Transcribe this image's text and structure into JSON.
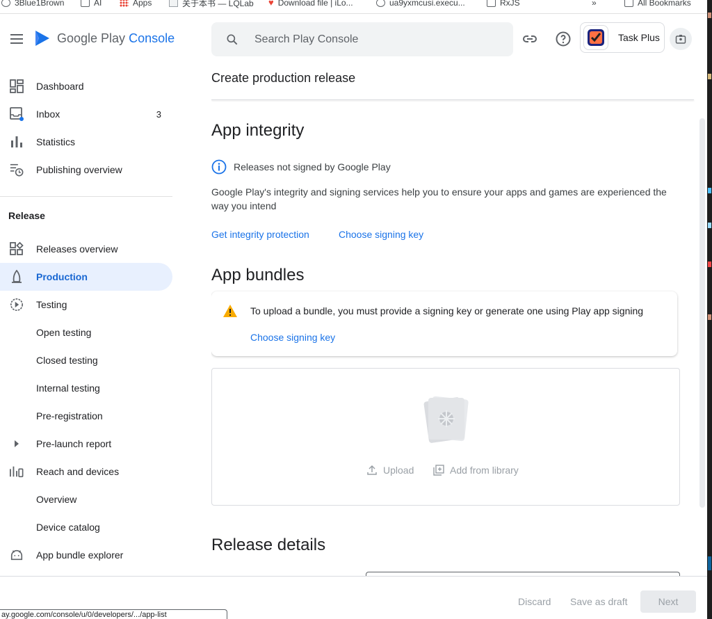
{
  "bookmarks": [
    {
      "label": "3Blue1Brown",
      "icon": "globe-icon"
    },
    {
      "label": "AI",
      "icon": "folder-icon"
    },
    {
      "label": "Apps",
      "icon": "apps-grid-icon"
    },
    {
      "label": "关于本书 — LQLab",
      "icon": "page-icon"
    },
    {
      "label": "Download file | iLo...",
      "icon": "heart-icon"
    },
    {
      "label": "ua9yxmcusi.execu...",
      "icon": "globe-icon"
    },
    {
      "label": "RxJS",
      "icon": "folder-icon"
    }
  ],
  "bookmarks_overflow": "»",
  "bookmarks_all": "All Bookmarks",
  "header": {
    "brand_google": "Google Play",
    "brand_console": "Console",
    "search_placeholder": "Search Play Console",
    "app_name": "Task Plus"
  },
  "sidebar": {
    "top_items": [
      {
        "label": "Dashboard",
        "icon": "dashboard-icon"
      },
      {
        "label": "Inbox",
        "icon": "inbox-icon",
        "count": "3"
      },
      {
        "label": "Statistics",
        "icon": "bar-chart-icon"
      },
      {
        "label": "Publishing overview",
        "icon": "publishing-icon"
      }
    ],
    "release_section": "Release",
    "release_items": [
      {
        "label": "Releases overview",
        "icon": "releases-overview-icon"
      },
      {
        "label": "Production",
        "icon": "production-icon",
        "active": true
      },
      {
        "label": "Testing",
        "icon": "testing-icon"
      },
      {
        "label": "Open testing"
      },
      {
        "label": "Closed testing"
      },
      {
        "label": "Internal testing"
      },
      {
        "label": "Pre-registration"
      },
      {
        "label": "Pre-launch report",
        "icon": "expand-arrow-icon"
      },
      {
        "label": "Reach and devices",
        "icon": "reach-devices-icon"
      },
      {
        "label": "Overview"
      },
      {
        "label": "Device catalog"
      },
      {
        "label": "App bundle explorer",
        "icon": "android-icon"
      }
    ]
  },
  "main": {
    "page_title": "Create production release",
    "integrity": {
      "heading": "App integrity",
      "status": "Releases not signed by Google Play",
      "description": "Google Play's integrity and signing services help you to ensure your apps and games are experienced the way you intend",
      "link_protection": "Get integrity protection",
      "link_signing": "Choose signing key"
    },
    "bundles": {
      "heading": "App bundles",
      "warning": "To upload a bundle, you must provide a signing key or generate one using Play app signing",
      "warning_link": "Choose signing key",
      "upload_label": "Upload",
      "library_label": "Add from library"
    },
    "release_details_heading": "Release details"
  },
  "footer": {
    "discard": "Discard",
    "save_draft": "Save as draft",
    "next": "Next"
  },
  "status_url": "ay.google.com/console/u/0/developers/.../app-list",
  "colors": {
    "accent": "#1a73e8",
    "active_bg": "#e8f0fe",
    "warning": "#f9ab00"
  }
}
